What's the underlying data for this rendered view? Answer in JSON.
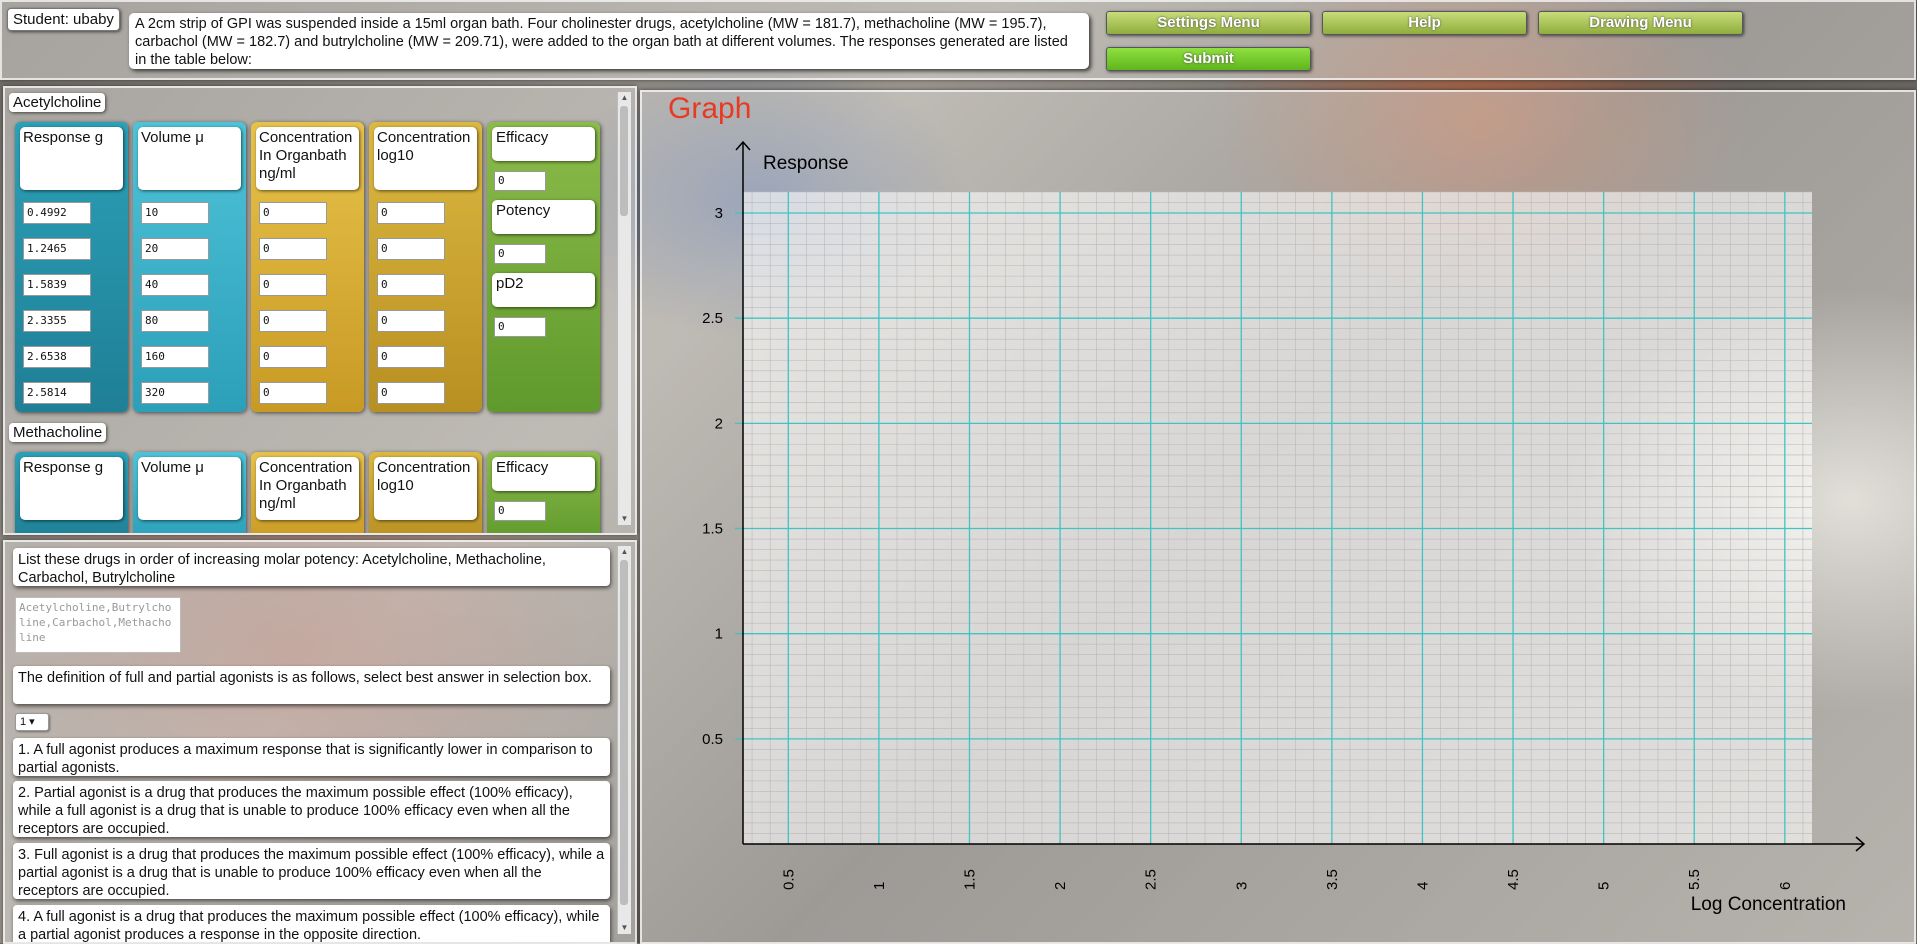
{
  "header": {
    "student_label": "Student: ubaby",
    "question_text": "A 2cm strip of GPI was suspended inside a 15ml organ bath. Four cholinester drugs, acetylcholine (MW = 181.7), methacholine (MW = 195.7), carbachol (MW = 182.7) and butrylcholine (MW = 209.71), were added to the organ bath at different volumes. The responses generated are listed in the table below:",
    "buttons": {
      "settings": "Settings Menu",
      "help": "Help",
      "drawing": "Drawing Menu",
      "submit": "Submit"
    }
  },
  "drugs": [
    {
      "name": "Acetylcholine",
      "headers": {
        "response": "Response g",
        "volume": "Volume μ",
        "concentration": "Concentration In Organbath ng/ml",
        "log": "Concentration log10",
        "efficacy": "Efficacy",
        "potency": "Potency",
        "pd2": "pD2"
      },
      "responses": [
        "0.4992",
        "1.2465",
        "1.5839",
        "2.3355",
        "2.6538",
        "2.5814"
      ],
      "volumes": [
        "10",
        "20",
        "40",
        "80",
        "160",
        "320"
      ],
      "concentrations": [
        "0",
        "0",
        "0",
        "0",
        "0",
        "0"
      ],
      "logs": [
        "0",
        "0",
        "0",
        "0",
        "0",
        "0"
      ],
      "efficacy": "0",
      "potency": "0",
      "pd2": "0"
    },
    {
      "name": "Methacholine",
      "headers": {
        "response": "Response g",
        "volume": "Volume μ",
        "concentration": "Concentration In Organbath ng/ml",
        "log": "Concentration log10",
        "efficacy": "Efficacy"
      },
      "efficacy": "0"
    }
  ],
  "questions": {
    "q1_text": "List these drugs in order of increasing molar potency: Acetylcholine, Methacholine, Carbachol, Butrylcholine",
    "q1_answer": "Acetylcholine,Butrylcholine,Carbachol,Methacholine",
    "q2_text": "The definition of full and partial agonists is as follows, select best answer in selection box.",
    "q2_selected": "1 ▾",
    "options": [
      "1. A full agonist produces a maximum response that is significantly lower in comparison to partial agonists.",
      "2. Partial agonist is a drug that produces the maximum possible effect (100% efficacy), while a full agonist is a drug that is unable to produce 100% efficacy even when all the receptors are occupied.",
      "3. Full agonist is a drug that produces the maximum possible effect (100% efficacy), while a partial agonist is a drug that is unable to produce 100% efficacy even when all the receptors are occupied.",
      "4. A full agonist is a drug that produces the maximum possible effect (100% efficacy), while a partial agonist produces a response in the opposite direction."
    ]
  },
  "graph": {
    "title": "Graph",
    "ylabel": "Response",
    "xlabel": "Log Concentration",
    "grid_color": "#3fc4c0",
    "title_color": "#e83a23"
  },
  "chart_data": {
    "type": "scatter",
    "title": "Graph",
    "xlabel": "Log Concentration",
    "ylabel": "Response",
    "xlim": [
      0.25,
      6.15
    ],
    "ylim": [
      0,
      3.1
    ],
    "xticks": [
      0.5,
      1,
      1.5,
      2,
      2.5,
      3,
      3.5,
      4,
      4.5,
      5,
      5.5,
      6
    ],
    "yticks": [
      0.5,
      1,
      1.5,
      2,
      2.5,
      3
    ],
    "xtick_labels": [
      "0.5",
      "1",
      "1.5",
      "2",
      "2.5",
      "3",
      "3.5",
      "4",
      "4.5",
      "5",
      "5.5",
      "6"
    ],
    "ytick_labels": [
      "0.5",
      "1",
      "1.5",
      "2",
      "2.5",
      "3"
    ],
    "grid": true,
    "series": []
  }
}
